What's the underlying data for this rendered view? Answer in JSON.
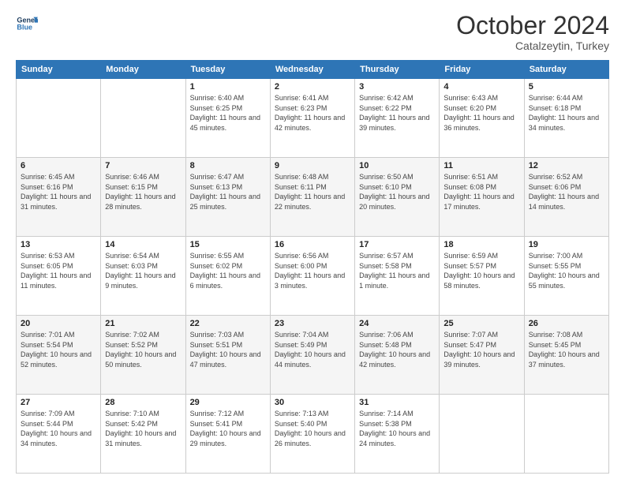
{
  "header": {
    "logo_line1": "General",
    "logo_line2": "Blue",
    "month": "October 2024",
    "location": "Catalzeytin, Turkey"
  },
  "weekdays": [
    "Sunday",
    "Monday",
    "Tuesday",
    "Wednesday",
    "Thursday",
    "Friday",
    "Saturday"
  ],
  "weeks": [
    [
      {
        "day": "",
        "info": ""
      },
      {
        "day": "",
        "info": ""
      },
      {
        "day": "1",
        "info": "Sunrise: 6:40 AM\nSunset: 6:25 PM\nDaylight: 11 hours and 45 minutes."
      },
      {
        "day": "2",
        "info": "Sunrise: 6:41 AM\nSunset: 6:23 PM\nDaylight: 11 hours and 42 minutes."
      },
      {
        "day": "3",
        "info": "Sunrise: 6:42 AM\nSunset: 6:22 PM\nDaylight: 11 hours and 39 minutes."
      },
      {
        "day": "4",
        "info": "Sunrise: 6:43 AM\nSunset: 6:20 PM\nDaylight: 11 hours and 36 minutes."
      },
      {
        "day": "5",
        "info": "Sunrise: 6:44 AM\nSunset: 6:18 PM\nDaylight: 11 hours and 34 minutes."
      }
    ],
    [
      {
        "day": "6",
        "info": "Sunrise: 6:45 AM\nSunset: 6:16 PM\nDaylight: 11 hours and 31 minutes."
      },
      {
        "day": "7",
        "info": "Sunrise: 6:46 AM\nSunset: 6:15 PM\nDaylight: 11 hours and 28 minutes."
      },
      {
        "day": "8",
        "info": "Sunrise: 6:47 AM\nSunset: 6:13 PM\nDaylight: 11 hours and 25 minutes."
      },
      {
        "day": "9",
        "info": "Sunrise: 6:48 AM\nSunset: 6:11 PM\nDaylight: 11 hours and 22 minutes."
      },
      {
        "day": "10",
        "info": "Sunrise: 6:50 AM\nSunset: 6:10 PM\nDaylight: 11 hours and 20 minutes."
      },
      {
        "day": "11",
        "info": "Sunrise: 6:51 AM\nSunset: 6:08 PM\nDaylight: 11 hours and 17 minutes."
      },
      {
        "day": "12",
        "info": "Sunrise: 6:52 AM\nSunset: 6:06 PM\nDaylight: 11 hours and 14 minutes."
      }
    ],
    [
      {
        "day": "13",
        "info": "Sunrise: 6:53 AM\nSunset: 6:05 PM\nDaylight: 11 hours and 11 minutes."
      },
      {
        "day": "14",
        "info": "Sunrise: 6:54 AM\nSunset: 6:03 PM\nDaylight: 11 hours and 9 minutes."
      },
      {
        "day": "15",
        "info": "Sunrise: 6:55 AM\nSunset: 6:02 PM\nDaylight: 11 hours and 6 minutes."
      },
      {
        "day": "16",
        "info": "Sunrise: 6:56 AM\nSunset: 6:00 PM\nDaylight: 11 hours and 3 minutes."
      },
      {
        "day": "17",
        "info": "Sunrise: 6:57 AM\nSunset: 5:58 PM\nDaylight: 11 hours and 1 minute."
      },
      {
        "day": "18",
        "info": "Sunrise: 6:59 AM\nSunset: 5:57 PM\nDaylight: 10 hours and 58 minutes."
      },
      {
        "day": "19",
        "info": "Sunrise: 7:00 AM\nSunset: 5:55 PM\nDaylight: 10 hours and 55 minutes."
      }
    ],
    [
      {
        "day": "20",
        "info": "Sunrise: 7:01 AM\nSunset: 5:54 PM\nDaylight: 10 hours and 52 minutes."
      },
      {
        "day": "21",
        "info": "Sunrise: 7:02 AM\nSunset: 5:52 PM\nDaylight: 10 hours and 50 minutes."
      },
      {
        "day": "22",
        "info": "Sunrise: 7:03 AM\nSunset: 5:51 PM\nDaylight: 10 hours and 47 minutes."
      },
      {
        "day": "23",
        "info": "Sunrise: 7:04 AM\nSunset: 5:49 PM\nDaylight: 10 hours and 44 minutes."
      },
      {
        "day": "24",
        "info": "Sunrise: 7:06 AM\nSunset: 5:48 PM\nDaylight: 10 hours and 42 minutes."
      },
      {
        "day": "25",
        "info": "Sunrise: 7:07 AM\nSunset: 5:47 PM\nDaylight: 10 hours and 39 minutes."
      },
      {
        "day": "26",
        "info": "Sunrise: 7:08 AM\nSunset: 5:45 PM\nDaylight: 10 hours and 37 minutes."
      }
    ],
    [
      {
        "day": "27",
        "info": "Sunrise: 7:09 AM\nSunset: 5:44 PM\nDaylight: 10 hours and 34 minutes."
      },
      {
        "day": "28",
        "info": "Sunrise: 7:10 AM\nSunset: 5:42 PM\nDaylight: 10 hours and 31 minutes."
      },
      {
        "day": "29",
        "info": "Sunrise: 7:12 AM\nSunset: 5:41 PM\nDaylight: 10 hours and 29 minutes."
      },
      {
        "day": "30",
        "info": "Sunrise: 7:13 AM\nSunset: 5:40 PM\nDaylight: 10 hours and 26 minutes."
      },
      {
        "day": "31",
        "info": "Sunrise: 7:14 AM\nSunset: 5:38 PM\nDaylight: 10 hours and 24 minutes."
      },
      {
        "day": "",
        "info": ""
      },
      {
        "day": "",
        "info": ""
      }
    ]
  ]
}
